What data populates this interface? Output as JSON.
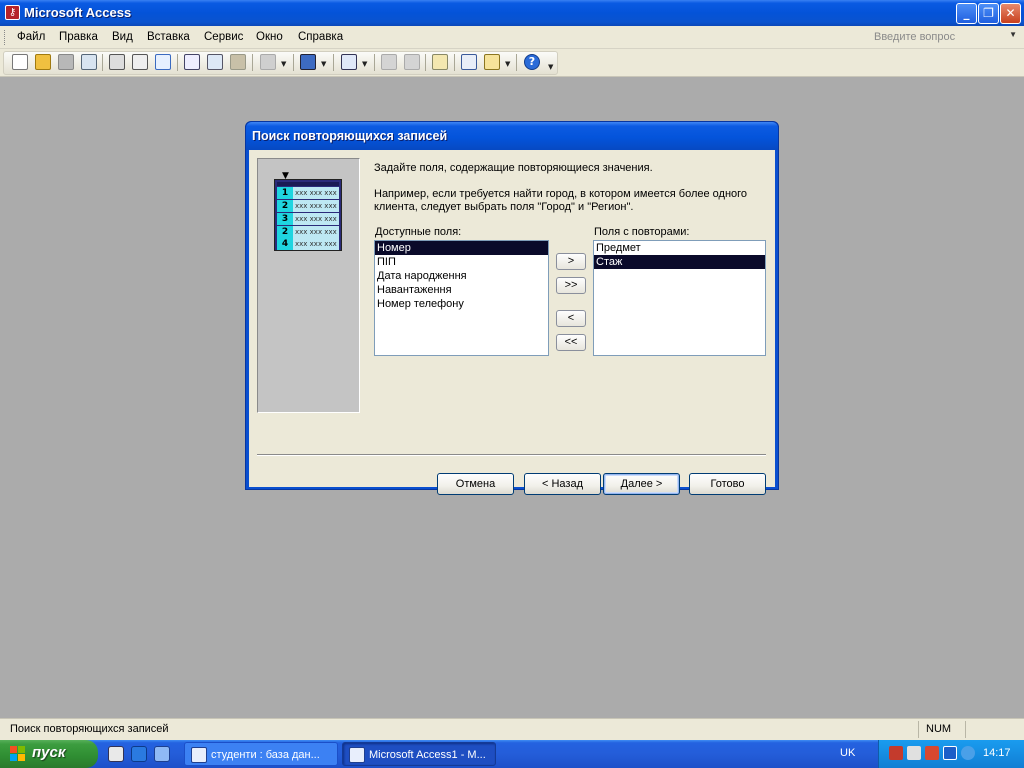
{
  "window": {
    "title": "Microsoft Access",
    "minimize_glyph": "_",
    "restore_glyph": "❐",
    "close_glyph": "✕"
  },
  "menu": {
    "items": [
      "Файл",
      "Правка",
      "Вид",
      "Вставка",
      "Сервис",
      "Окно",
      "Справка"
    ],
    "help_placeholder": "Введите вопрос"
  },
  "toolbar": {
    "icons": [
      "new-icon",
      "open-icon",
      "save-icon",
      "search-icon",
      "print-icon",
      "print-preview-icon",
      "spelling-icon",
      "cut-icon",
      "copy-icon",
      "paste-icon",
      "undo-icon",
      "office-links-icon",
      "analyze-icon",
      "properties-icon",
      "relationships-icon",
      "new-object-icon",
      "help-icon"
    ]
  },
  "dialog": {
    "title": "Поиск повторяющихся записей",
    "instruction": "Задайте поля, содержащие повторяющиеся значения.",
    "example_line1": "Например, если требуется найти город, в котором имеется более одного",
    "example_line2": "клиента, следует выбрать поля \"Город\" и \"Регион\".",
    "available_label": "Доступные поля:",
    "repeats_label": "Поля с повторами:",
    "available_fields": [
      "Номер",
      "ПІП",
      "Дата народження",
      "Навантаження",
      "Номер телефону"
    ],
    "available_selected_index": 0,
    "repeat_fields": [
      "Предмет",
      "Стаж"
    ],
    "repeat_selected_index": 1,
    "move_buttons": {
      "add_one": ">",
      "add_all": ">>",
      "remove_one": "<",
      "remove_all": "<<"
    },
    "illustration": {
      "row_numbers": [
        "1",
        "2",
        "3",
        "2",
        "4"
      ],
      "row_text": "xxx xxx xxx"
    },
    "buttons": {
      "cancel": "Отмена",
      "back": "< Назад",
      "next": "Далее >",
      "finish": "Готово"
    }
  },
  "statusbar": {
    "text": "Поиск повторяющихся записей",
    "num": "NUM"
  },
  "taskbar": {
    "start_label": "пуск",
    "tasks": [
      "студенти : база дан...",
      "Microsoft Access1 - M..."
    ],
    "language": "UK",
    "clock": "14:17"
  }
}
